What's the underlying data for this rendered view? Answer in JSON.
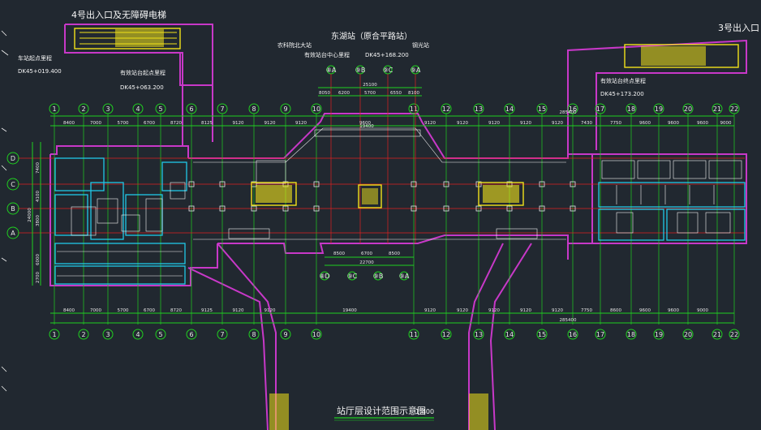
{
  "colors": {
    "background": "#212830",
    "wall": "#c838c8",
    "axis_green": "#20d020",
    "axis_red": "#e02020",
    "dim_white": "#e8e8e8",
    "stair_yellow": "#f2e21a",
    "structure_cyan": "#20c8e8",
    "panel_white": "#f4f4f4"
  },
  "title": {
    "main": "站厅层设计范围示意图",
    "scale": "1:400"
  },
  "labels": {
    "exit4": "4号出入口及无障碍电梯",
    "exit3": "3号出入口",
    "station": "东湖站（原合平路站）",
    "west_neighbor": "农科院北大站",
    "east_neighbor": "钢光站",
    "center_mileage": "有效站台中心里程",
    "center_mileage_val": "DK45+168.200",
    "start_mileage_label": "车站起点里程",
    "start_mileage_val": "DK45+019.400",
    "platform_start_label": "有效站台起点里程",
    "platform_start_val": "DK45+063.200",
    "platform_end_label": "有效站台终点里程",
    "platform_end_val": "DK45+173.200"
  },
  "axes": {
    "columns_top": [
      "1",
      "2",
      "3",
      "4",
      "5",
      "6",
      "7",
      "8",
      "9",
      "10",
      "11",
      "12",
      "13",
      "14",
      "15",
      "16",
      "17",
      "18",
      "19",
      "20",
      "21",
      "22"
    ],
    "columns_bottom": [
      "1",
      "2",
      "3",
      "4",
      "5",
      "6",
      "7",
      "8",
      "9",
      "10",
      "11",
      "12",
      "13",
      "14",
      "15",
      "16",
      "17",
      "18",
      "19",
      "20",
      "21",
      "22"
    ],
    "rows": [
      "D",
      "C",
      "B",
      "A"
    ],
    "sub_axes_top": [
      "⑧A",
      "⑨B",
      "⑨C",
      "⑨A"
    ],
    "sub_axes_bottom": [
      "⑧D",
      "⑨C",
      "⑨B",
      "⑨A"
    ]
  },
  "dimensions": {
    "top_spans": [
      "8400",
      "7000",
      "5700",
      "6700",
      "8720",
      "8125",
      "9120",
      "9120",
      "9120",
      "9600",
      "9120",
      "9120",
      "9120",
      "9120",
      "9120",
      "7430",
      "7750",
      "9600",
      "9600",
      "9600",
      "9000"
    ],
    "bottom_spans": [
      "8400",
      "7000",
      "5700",
      "6700",
      "8720",
      "9125",
      "9120",
      "9120",
      "19400",
      "9120",
      "9120",
      "9120",
      "9120",
      "9120",
      "7750",
      "8600",
      "9600",
      "9600",
      "9000"
    ],
    "top_total": "285400",
    "bottom_total": "285400",
    "center_top_total": "25100",
    "center_top_spans": [
      "8050",
      "6200",
      "5700",
      "6550",
      "8100"
    ],
    "center_mid": "19400",
    "center_bottom_spans": [
      "8500",
      "6700",
      "8500"
    ],
    "center_bottom_total": "22700",
    "left_rows": [
      "7400",
      "4100",
      "3800",
      "6000",
      "2700"
    ],
    "left_total": "24000"
  }
}
